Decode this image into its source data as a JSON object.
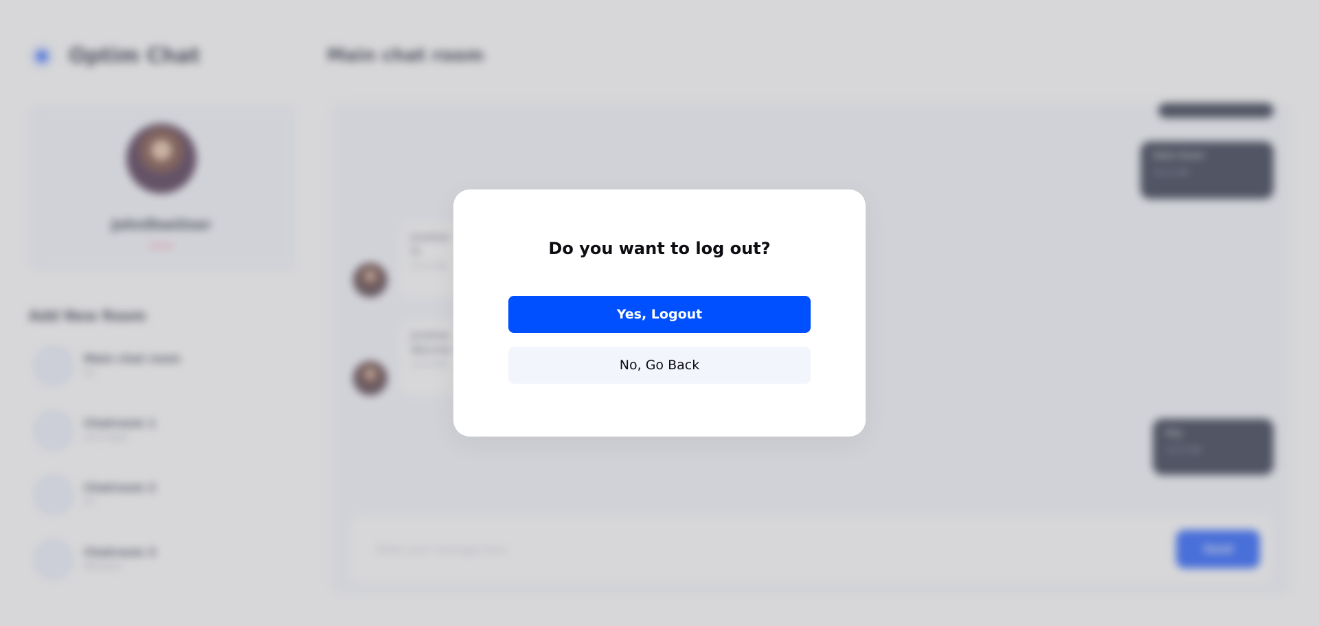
{
  "app": {
    "logo_text": "Optim Chat",
    "logo_icon": "chat-logo-icon"
  },
  "profile": {
    "name": "JohnDoeUser",
    "status": "Online"
  },
  "sidebar": {
    "section_title": "Add New Room",
    "rooms": [
      {
        "name": "Main chat room",
        "sub": "Hi!"
      },
      {
        "name": "Chatroom 1",
        "sub": "Let's begin"
      },
      {
        "name": "Chatroom 2",
        "sub": "Hi!"
      },
      {
        "name": "Chatroom 3",
        "sub": "Welcome"
      }
    ]
  },
  "main": {
    "title": "Main chat room"
  },
  "messages": {
    "outgoing_1": {
      "text": "Hello there!",
      "time": "10:12 AM"
    },
    "outgoing_2": {
      "text": "Hey",
      "time": "10:15 AM"
    },
    "incoming_1": {
      "author": "Jonathan",
      "text": "Hi",
      "time": "10:13 AM"
    },
    "incoming_2": {
      "author": "Jonathan",
      "text": "Welcome",
      "time": "10:14 AM"
    }
  },
  "composer": {
    "placeholder": "Write your message here",
    "send_label": "Send"
  },
  "modal": {
    "title": "Do you want to log out?",
    "confirm_label": "Yes, Logout",
    "cancel_label": "No, Go Back"
  },
  "colors": {
    "primary": "#0050FF",
    "secondary_button": "#F2F5FB",
    "dark_bubble": "#1A1F36"
  }
}
